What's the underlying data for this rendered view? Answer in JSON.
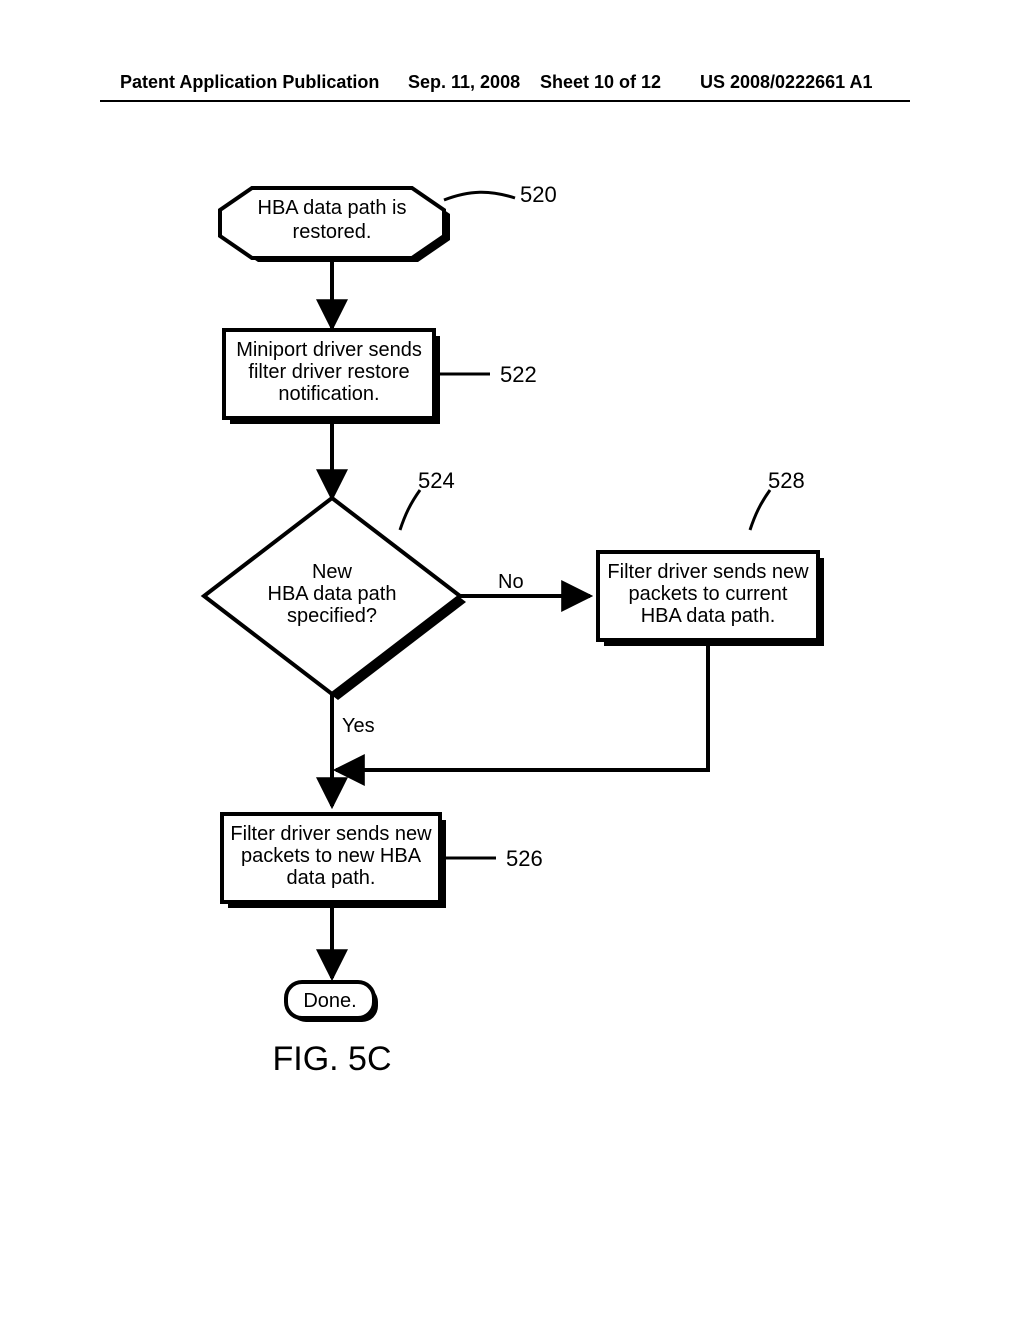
{
  "header": {
    "left": "Patent Application Publication",
    "date": "Sep. 11, 2008",
    "sheet": "Sheet 10 of 12",
    "pubno": "US 2008/0222661 A1"
  },
  "nodes": {
    "n520": {
      "ref": "520",
      "line1": "HBA data path is",
      "line2": "restored."
    },
    "n522": {
      "ref": "522",
      "line1": "Miniport driver sends",
      "line2": "filter driver restore",
      "line3": "notification."
    },
    "n524": {
      "ref": "524",
      "line1": "New",
      "line2": "HBA data path",
      "line3": "specified?"
    },
    "n526": {
      "ref": "526",
      "line1": "Filter driver sends new",
      "line2": "packets to new HBA",
      "line3": "data path."
    },
    "n528": {
      "ref": "528",
      "line1": "Filter driver sends new",
      "line2": "packets to current",
      "line3": "HBA data path."
    },
    "done": {
      "label": "Done."
    }
  },
  "edges": {
    "no": "No",
    "yes": "Yes"
  },
  "figure": {
    "title": "FIG. 5C"
  }
}
